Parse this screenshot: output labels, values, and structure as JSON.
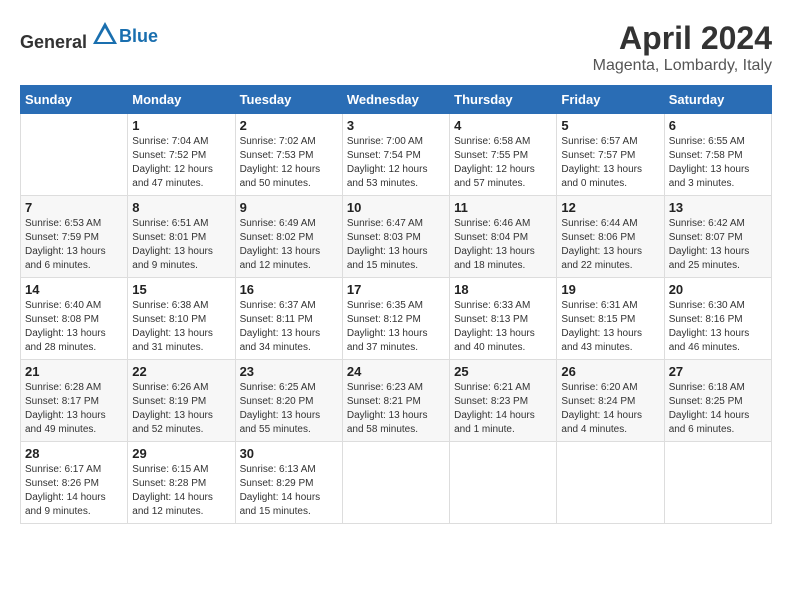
{
  "header": {
    "logo_general": "General",
    "logo_blue": "Blue",
    "title": "April 2024",
    "subtitle": "Magenta, Lombardy, Italy"
  },
  "days_of_week": [
    "Sunday",
    "Monday",
    "Tuesday",
    "Wednesday",
    "Thursday",
    "Friday",
    "Saturday"
  ],
  "weeks": [
    [
      {
        "day": "",
        "info": ""
      },
      {
        "day": "1",
        "info": "Sunrise: 7:04 AM\nSunset: 7:52 PM\nDaylight: 12 hours\nand 47 minutes."
      },
      {
        "day": "2",
        "info": "Sunrise: 7:02 AM\nSunset: 7:53 PM\nDaylight: 12 hours\nand 50 minutes."
      },
      {
        "day": "3",
        "info": "Sunrise: 7:00 AM\nSunset: 7:54 PM\nDaylight: 12 hours\nand 53 minutes."
      },
      {
        "day": "4",
        "info": "Sunrise: 6:58 AM\nSunset: 7:55 PM\nDaylight: 12 hours\nand 57 minutes."
      },
      {
        "day": "5",
        "info": "Sunrise: 6:57 AM\nSunset: 7:57 PM\nDaylight: 13 hours\nand 0 minutes."
      },
      {
        "day": "6",
        "info": "Sunrise: 6:55 AM\nSunset: 7:58 PM\nDaylight: 13 hours\nand 3 minutes."
      }
    ],
    [
      {
        "day": "7",
        "info": "Sunrise: 6:53 AM\nSunset: 7:59 PM\nDaylight: 13 hours\nand 6 minutes."
      },
      {
        "day": "8",
        "info": "Sunrise: 6:51 AM\nSunset: 8:01 PM\nDaylight: 13 hours\nand 9 minutes."
      },
      {
        "day": "9",
        "info": "Sunrise: 6:49 AM\nSunset: 8:02 PM\nDaylight: 13 hours\nand 12 minutes."
      },
      {
        "day": "10",
        "info": "Sunrise: 6:47 AM\nSunset: 8:03 PM\nDaylight: 13 hours\nand 15 minutes."
      },
      {
        "day": "11",
        "info": "Sunrise: 6:46 AM\nSunset: 8:04 PM\nDaylight: 13 hours\nand 18 minutes."
      },
      {
        "day": "12",
        "info": "Sunrise: 6:44 AM\nSunset: 8:06 PM\nDaylight: 13 hours\nand 22 minutes."
      },
      {
        "day": "13",
        "info": "Sunrise: 6:42 AM\nSunset: 8:07 PM\nDaylight: 13 hours\nand 25 minutes."
      }
    ],
    [
      {
        "day": "14",
        "info": "Sunrise: 6:40 AM\nSunset: 8:08 PM\nDaylight: 13 hours\nand 28 minutes."
      },
      {
        "day": "15",
        "info": "Sunrise: 6:38 AM\nSunset: 8:10 PM\nDaylight: 13 hours\nand 31 minutes."
      },
      {
        "day": "16",
        "info": "Sunrise: 6:37 AM\nSunset: 8:11 PM\nDaylight: 13 hours\nand 34 minutes."
      },
      {
        "day": "17",
        "info": "Sunrise: 6:35 AM\nSunset: 8:12 PM\nDaylight: 13 hours\nand 37 minutes."
      },
      {
        "day": "18",
        "info": "Sunrise: 6:33 AM\nSunset: 8:13 PM\nDaylight: 13 hours\nand 40 minutes."
      },
      {
        "day": "19",
        "info": "Sunrise: 6:31 AM\nSunset: 8:15 PM\nDaylight: 13 hours\nand 43 minutes."
      },
      {
        "day": "20",
        "info": "Sunrise: 6:30 AM\nSunset: 8:16 PM\nDaylight: 13 hours\nand 46 minutes."
      }
    ],
    [
      {
        "day": "21",
        "info": "Sunrise: 6:28 AM\nSunset: 8:17 PM\nDaylight: 13 hours\nand 49 minutes."
      },
      {
        "day": "22",
        "info": "Sunrise: 6:26 AM\nSunset: 8:19 PM\nDaylight: 13 hours\nand 52 minutes."
      },
      {
        "day": "23",
        "info": "Sunrise: 6:25 AM\nSunset: 8:20 PM\nDaylight: 13 hours\nand 55 minutes."
      },
      {
        "day": "24",
        "info": "Sunrise: 6:23 AM\nSunset: 8:21 PM\nDaylight: 13 hours\nand 58 minutes."
      },
      {
        "day": "25",
        "info": "Sunrise: 6:21 AM\nSunset: 8:23 PM\nDaylight: 14 hours\nand 1 minute."
      },
      {
        "day": "26",
        "info": "Sunrise: 6:20 AM\nSunset: 8:24 PM\nDaylight: 14 hours\nand 4 minutes."
      },
      {
        "day": "27",
        "info": "Sunrise: 6:18 AM\nSunset: 8:25 PM\nDaylight: 14 hours\nand 6 minutes."
      }
    ],
    [
      {
        "day": "28",
        "info": "Sunrise: 6:17 AM\nSunset: 8:26 PM\nDaylight: 14 hours\nand 9 minutes."
      },
      {
        "day": "29",
        "info": "Sunrise: 6:15 AM\nSunset: 8:28 PM\nDaylight: 14 hours\nand 12 minutes."
      },
      {
        "day": "30",
        "info": "Sunrise: 6:13 AM\nSunset: 8:29 PM\nDaylight: 14 hours\nand 15 minutes."
      },
      {
        "day": "",
        "info": ""
      },
      {
        "day": "",
        "info": ""
      },
      {
        "day": "",
        "info": ""
      },
      {
        "day": "",
        "info": ""
      }
    ]
  ]
}
